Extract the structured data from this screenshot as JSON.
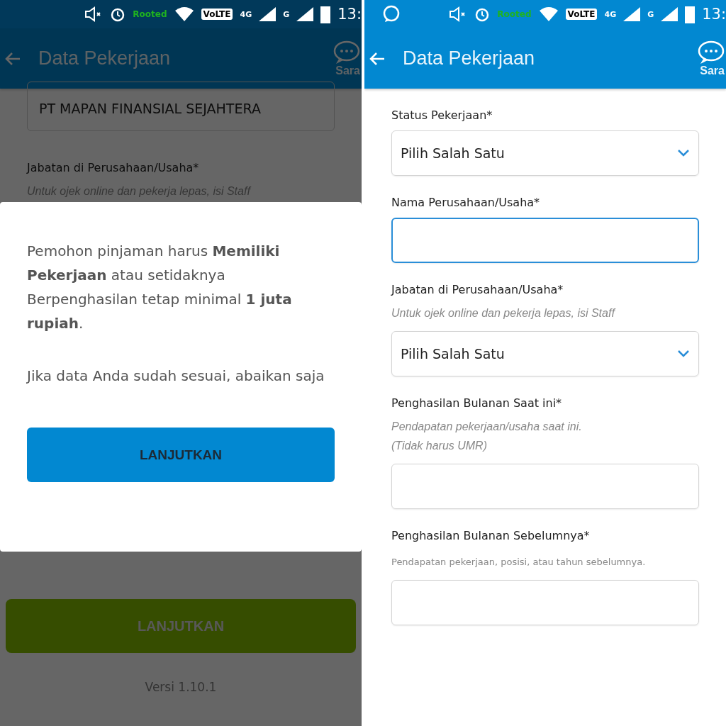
{
  "left_screen": {
    "status_bar": {
      "carrier_tag": "Rooted",
      "network": [
        "VoLTE",
        "4G",
        "G"
      ],
      "time": "13:"
    },
    "app_bar": {
      "title": "Data Pekerjaan",
      "action": "Sara"
    },
    "background_form": {
      "company_value": "PT MAPAN FINANSIAL SEJAHTERA",
      "label": "Jabatan di Perusahaan/Usaha*",
      "hint": "Untuk ojek online dan pekerja lepas, isi Staff"
    },
    "dialog": {
      "paragraphs": [
        "Pemohon pinjaman harus **Memiliki Pekerjaan** atau setidaknya Berpenghasilan tetap minimal **1 juta rupiah**.",
        "Jika data Anda sudah sesuai, abaikan saja"
      ],
      "button": "LANJUTKAN"
    },
    "submit_button": "LANJUTKAN",
    "version": "Versi 1.10.1"
  },
  "right_screen": {
    "status_bar": {
      "carrier_tag": "Rooted",
      "network": [
        "VoLTE",
        "4G",
        "G"
      ],
      "time": "13:"
    },
    "app_bar": {
      "title": "Data Pekerjaan",
      "action": "Sara"
    },
    "fields": [
      {
        "kind": "select",
        "label": "Status Pekerjaan*",
        "value": "Pilih Salah Satu",
        "focused": false
      },
      {
        "kind": "text",
        "label": "Nama Perusahaan/Usaha*",
        "focused": true
      },
      {
        "kind": "select",
        "label": "Jabatan di Perusahaan/Usaha*",
        "hint": "Untuk ojek online dan pekerja lepas, isi Staff",
        "value": "Pilih Salah Satu",
        "focused": false
      },
      {
        "kind": "text",
        "label": "Penghasilan Bulanan Saat ini*",
        "hint": "Pendapatan pekerjaan/usaha saat ini.\n(Tidak harus UMR)",
        "focused": false
      },
      {
        "kind": "text",
        "label": "Penghasilan Bulanan Sebelumnya*",
        "hint": "Pendapatan pekerjaan, posisi, atau tahun sebelumnya.",
        "small_hint": true,
        "focused": false
      }
    ]
  }
}
